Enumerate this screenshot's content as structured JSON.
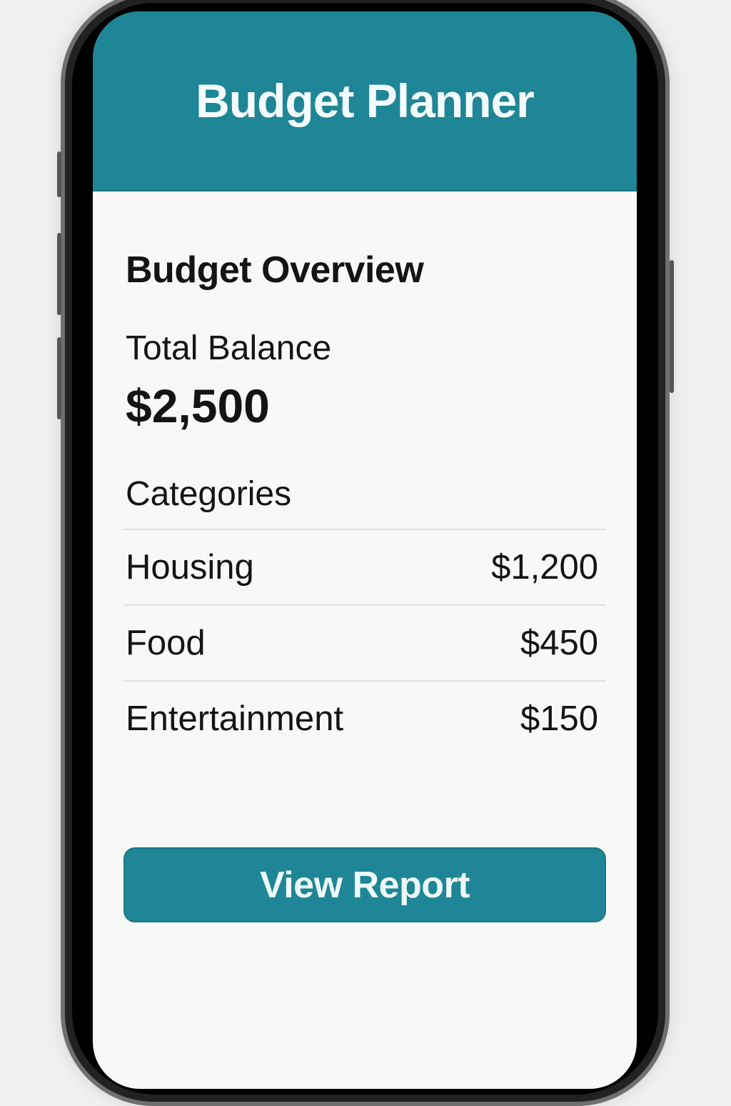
{
  "header": {
    "title": "Budget Planner"
  },
  "overview": {
    "heading": "Budget Overview",
    "balance_label": "Total Balance",
    "balance_value": "$2,500",
    "categories_heading": "Categories"
  },
  "categories": [
    {
      "name": "Housing",
      "amount": "$1,200"
    },
    {
      "name": "Food",
      "amount": "$450"
    },
    {
      "name": "Entertainment",
      "amount": "$150"
    }
  ],
  "actions": {
    "view_report": "View Report"
  },
  "colors": {
    "accent": "#1e8696",
    "background": "#f8f8f6"
  }
}
